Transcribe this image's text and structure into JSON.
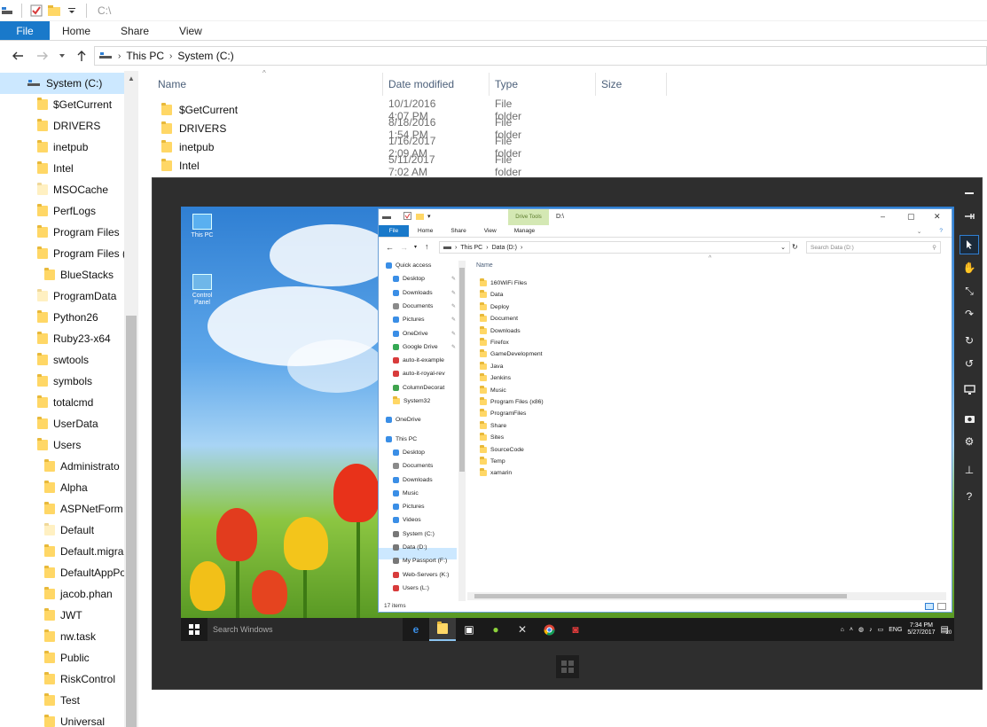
{
  "titlebar": {
    "path": "C:\\"
  },
  "ribbon": {
    "tabs": [
      "File",
      "Home",
      "Share",
      "View"
    ]
  },
  "address": {
    "crumbs": [
      "This PC",
      "System (C:)"
    ]
  },
  "nav": {
    "selected": "System (C:)",
    "items": [
      {
        "label": "$GetCurrent",
        "indent": 1,
        "pale": false
      },
      {
        "label": "DRIVERS",
        "indent": 1,
        "pale": false
      },
      {
        "label": "inetpub",
        "indent": 1,
        "pale": false
      },
      {
        "label": "Intel",
        "indent": 1,
        "pale": false
      },
      {
        "label": "MSOCache",
        "indent": 1,
        "pale": true
      },
      {
        "label": "PerfLogs",
        "indent": 1,
        "pale": false
      },
      {
        "label": "Program Files",
        "indent": 1,
        "pale": false
      },
      {
        "label": "Program Files (",
        "indent": 1,
        "pale": false
      },
      {
        "label": "BlueStacks",
        "indent": 2,
        "pale": false
      },
      {
        "label": "ProgramData",
        "indent": 1,
        "pale": true
      },
      {
        "label": "Python26",
        "indent": 1,
        "pale": false
      },
      {
        "label": "Ruby23-x64",
        "indent": 1,
        "pale": false
      },
      {
        "label": "swtools",
        "indent": 1,
        "pale": false
      },
      {
        "label": "symbols",
        "indent": 1,
        "pale": false
      },
      {
        "label": "totalcmd",
        "indent": 1,
        "pale": false
      },
      {
        "label": "UserData",
        "indent": 1,
        "pale": false
      },
      {
        "label": "Users",
        "indent": 1,
        "pale": false
      },
      {
        "label": "Administrato",
        "indent": 2,
        "pale": false
      },
      {
        "label": "Alpha",
        "indent": 2,
        "pale": false
      },
      {
        "label": "ASPNetForm",
        "indent": 2,
        "pale": false
      },
      {
        "label": "Default",
        "indent": 2,
        "pale": true
      },
      {
        "label": "Default.migra",
        "indent": 2,
        "pale": false
      },
      {
        "label": "DefaultAppPo",
        "indent": 2,
        "pale": false
      },
      {
        "label": "jacob.phan",
        "indent": 2,
        "pale": false
      },
      {
        "label": "JWT",
        "indent": 2,
        "pale": false
      },
      {
        "label": "nw.task",
        "indent": 2,
        "pale": false
      },
      {
        "label": "Public",
        "indent": 2,
        "pale": false
      },
      {
        "label": "RiskControl",
        "indent": 2,
        "pale": false
      },
      {
        "label": "Test",
        "indent": 2,
        "pale": false
      },
      {
        "label": "Universal",
        "indent": 2,
        "pale": false
      }
    ]
  },
  "columns": [
    "Name",
    "Date modified",
    "Type",
    "Size"
  ],
  "rows": [
    {
      "name": "$GetCurrent",
      "date": "10/1/2016 4:07 PM",
      "type": "File folder"
    },
    {
      "name": "DRIVERS",
      "date": "8/18/2016 1:54 PM",
      "type": "File folder"
    },
    {
      "name": "inetpub",
      "date": "1/16/2017 2:09 AM",
      "type": "File folder"
    },
    {
      "name": "Intel",
      "date": "5/11/2017 7:02 AM",
      "type": "File folder"
    }
  ],
  "remote": {
    "desktop_icons": [
      "This PC",
      "Control Panel"
    ],
    "taskbar": {
      "search_placeholder": "Search Windows",
      "lang": "ENG",
      "time": "7:34 PM",
      "date": "5/27/2017",
      "notif_count": "20"
    },
    "explorer": {
      "context_tab": "Drive Tools",
      "path": "D:\\",
      "tabs": [
        "File",
        "Home",
        "Share",
        "View",
        "Manage"
      ],
      "crumbs": [
        "This PC",
        "Data (D:)"
      ],
      "search_placeholder": "Search Data (D:)",
      "list_header": "Name",
      "status": "17 items",
      "nav": [
        {
          "label": "Quick access",
          "kind": "star",
          "indent": 0,
          "pin": false
        },
        {
          "label": "Desktop",
          "kind": "blue",
          "indent": 1,
          "pin": true
        },
        {
          "label": "Downloads",
          "kind": "blue",
          "indent": 1,
          "pin": true
        },
        {
          "label": "Documents",
          "kind": "doc",
          "indent": 1,
          "pin": true
        },
        {
          "label": "Pictures",
          "kind": "blue",
          "indent": 1,
          "pin": true
        },
        {
          "label": "OneDrive",
          "kind": "cloud",
          "indent": 1,
          "pin": true
        },
        {
          "label": "Google Drive",
          "kind": "gdrive",
          "indent": 1,
          "pin": true
        },
        {
          "label": "auto-it-example",
          "kind": "red",
          "indent": 1,
          "pin": false
        },
        {
          "label": "auto-it-royal-rev",
          "kind": "red",
          "indent": 1,
          "pin": false
        },
        {
          "label": "ColumnDecorat",
          "kind": "green",
          "indent": 1,
          "pin": false
        },
        {
          "label": "System32",
          "kind": "folder",
          "indent": 1,
          "pin": false
        },
        {
          "label": "OneDrive",
          "kind": "cloud",
          "indent": 0,
          "pin": false
        },
        {
          "label": "This PC",
          "kind": "pc",
          "indent": 0,
          "pin": false
        },
        {
          "label": "Desktop",
          "kind": "blue",
          "indent": 1,
          "pin": false
        },
        {
          "label": "Documents",
          "kind": "doc",
          "indent": 1,
          "pin": false
        },
        {
          "label": "Downloads",
          "kind": "blue",
          "indent": 1,
          "pin": false
        },
        {
          "label": "Music",
          "kind": "music",
          "indent": 1,
          "pin": false
        },
        {
          "label": "Pictures",
          "kind": "blue",
          "indent": 1,
          "pin": false
        },
        {
          "label": "Videos",
          "kind": "video",
          "indent": 1,
          "pin": false
        },
        {
          "label": "System (C:)",
          "kind": "drive",
          "indent": 1,
          "pin": false
        },
        {
          "label": "Data (D:)",
          "kind": "drive",
          "indent": 1,
          "pin": false
        },
        {
          "label": "My Passport (F:)",
          "kind": "drive",
          "indent": 1,
          "pin": false
        },
        {
          "label": "Web-Servers (K:)",
          "kind": "net",
          "indent": 1,
          "pin": false
        },
        {
          "label": "Users (L:)",
          "kind": "net",
          "indent": 1,
          "pin": false
        }
      ],
      "selected_nav": "Data (D:)",
      "items": [
        "160WiFi Files",
        "Data",
        "Deploy",
        "Document",
        "Downloads",
        "Firefox",
        "GameDevelopment",
        "Java",
        "Jenkins",
        "Music",
        "Program Files (x86)",
        "ProgramFiles",
        "Share",
        "Sites",
        "SourceCode",
        "Temp",
        "xamarin"
      ]
    }
  },
  "colors": {
    "accent": "#1979ca",
    "selection": "#cce8ff",
    "folder": "#ffd766",
    "frame": "#2e2e2e"
  }
}
